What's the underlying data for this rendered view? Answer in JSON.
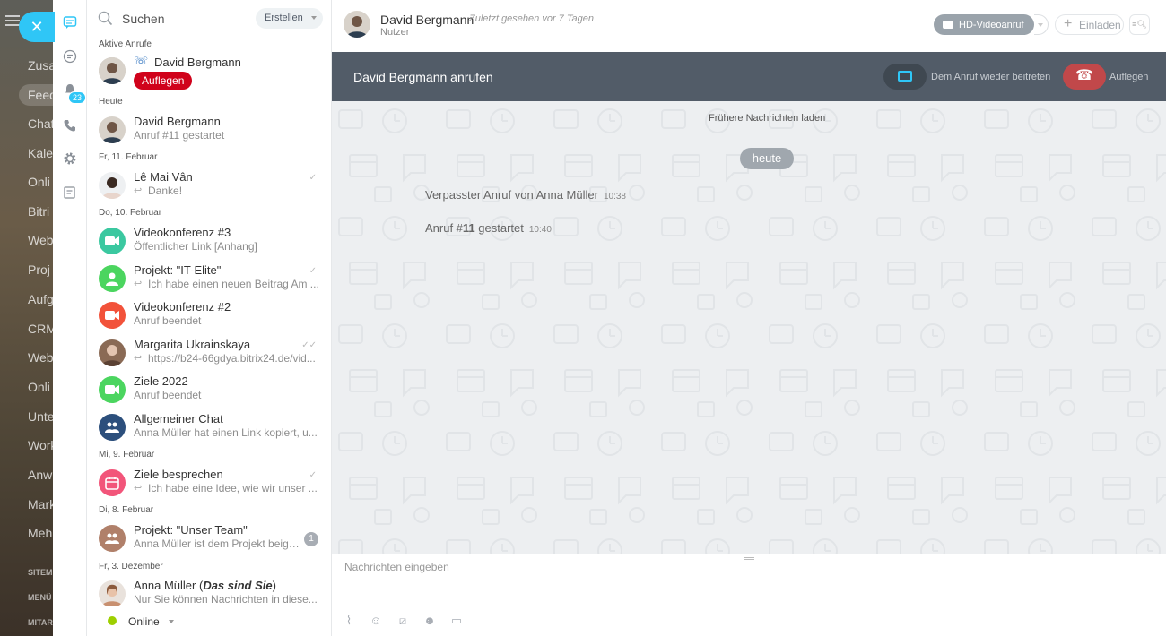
{
  "bg_nav": {
    "items": [
      "Zusa",
      "Feed",
      "Chat",
      "Kale",
      "Onli",
      "Bitri",
      "Web",
      "Proj",
      "Aufg",
      "CRM",
      "Web",
      "Onli",
      "Unte",
      "Work",
      "Anw",
      "Mark",
      "Meh"
    ],
    "active_index": 1,
    "small": [
      "SITEM",
      "MENÜ",
      "MITAR"
    ]
  },
  "sidebar": {
    "badge": "23"
  },
  "list": {
    "search_label": "Suchen",
    "create_label": "Erstellen",
    "sections": {
      "active_calls": "Aktive Anrufe",
      "today": "Heute",
      "feb11": "Fr, 11. Februar",
      "feb10": "Do, 10. Februar",
      "feb9": "Mi, 9. Februar",
      "feb8": "Di, 8. Februar",
      "dec3": "Fr, 3. Dezember"
    },
    "active_call": {
      "name": "David Bergmann",
      "button": "Auflegen"
    },
    "chats": [
      {
        "name": "David Bergmann",
        "sub": "Anruf #11 gestartet"
      },
      {
        "name": "Lê Mai Vân",
        "sub": "Danke!"
      },
      {
        "name": "Videokonferenz #3",
        "sub": "Öffentlicher Link [Anhang]"
      },
      {
        "name": "Projekt: \"IT-Elite\"",
        "sub": "Ich habe einen neuen Beitrag Am ..."
      },
      {
        "name": "Videokonferenz #2",
        "sub": "Anruf beendet"
      },
      {
        "name": "Margarita Ukrainskaya",
        "sub": "https://b24-66gdya.bitrix24.de/vid..."
      },
      {
        "name": "Ziele 2022",
        "sub": "Anruf beendet"
      },
      {
        "name": "Allgemeiner Chat",
        "sub": "Anna Müller hat einen Link kopiert, u..."
      },
      {
        "name": "Ziele besprechen",
        "sub": "Ich habe eine Idee, wie wir unser ..."
      },
      {
        "name": "Projekt: \"Unser Team\"",
        "sub": "Anna Müller ist dem Projekt beige...",
        "count": "1"
      },
      {
        "name_prefix": "Anna Müller (",
        "name_em": "Das sind Sie",
        "name_suffix": ")",
        "sub": "Nur Sie können Nachrichten in diese..."
      }
    ],
    "status": "Online"
  },
  "header": {
    "name": "David Bergmann",
    "seen": "Zuletzt gesehen vor 7 Tagen",
    "role": "Nutzer",
    "hd_button": "HD-Videoanruf",
    "invite_button": "Einladen"
  },
  "callbar": {
    "title": "David Bergmann anrufen",
    "rejoin_label": "Dem Anruf wieder beitreten",
    "hangup_label": "Auflegen"
  },
  "chat": {
    "load_more": "Frühere Nachrichten laden",
    "date": "heute",
    "messages": [
      {
        "text": "Verpasster Anruf von Anna Müller",
        "time": "10:38"
      },
      {
        "text_prefix": "Anruf #",
        "text_bold": "11",
        "text_suffix": " gestartet",
        "time": "10:40"
      }
    ]
  },
  "composer": {
    "placeholder": "Nachrichten eingeben"
  },
  "colors": {
    "accent": "#2fc6f6",
    "hangup": "#d0021b",
    "callbar": "#525c68",
    "online": "#9dcf00"
  }
}
